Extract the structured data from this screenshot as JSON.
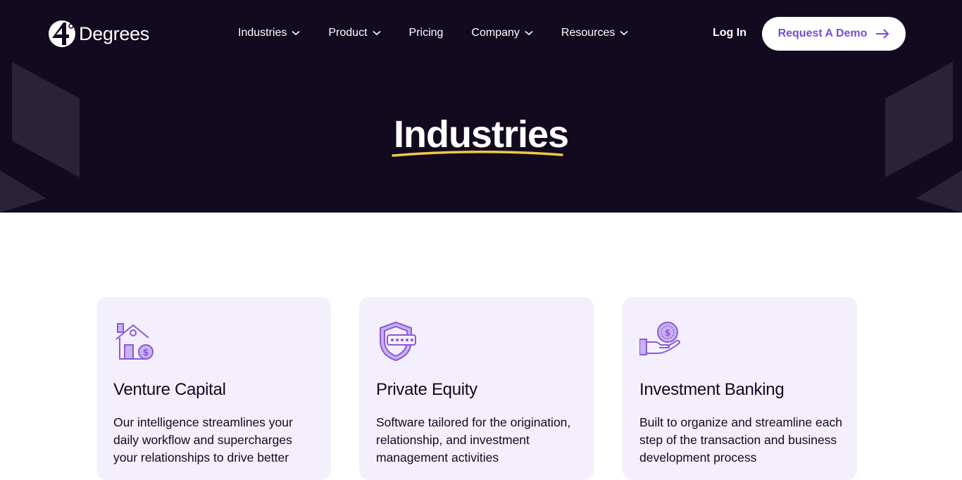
{
  "brand": {
    "logo_text": "Degrees",
    "logo_mark": "4"
  },
  "nav": {
    "items": [
      {
        "label": "Industries",
        "has_dropdown": true
      },
      {
        "label": "Product",
        "has_dropdown": true
      },
      {
        "label": "Pricing",
        "has_dropdown": false
      },
      {
        "label": "Company",
        "has_dropdown": true
      },
      {
        "label": "Resources",
        "has_dropdown": true
      }
    ],
    "login_label": "Log In",
    "demo_label": "Request A Demo"
  },
  "hero": {
    "title": "Industries"
  },
  "cards": [
    {
      "icon": "house-dollar-icon",
      "title": "Venture Capital",
      "text": "Our intelligence streamlines your daily workflow and supercharges your relationships to drive better"
    },
    {
      "icon": "shield-password-icon",
      "title": "Private Equity",
      "text": "Software tailored for the origination, relationship, and investment management activities"
    },
    {
      "icon": "hand-coin-icon",
      "title": "Investment Banking",
      "text": "Built to organize and streamline each step of the transaction and business development process"
    }
  ],
  "colors": {
    "hero_bg": "#120a1f",
    "accent": "#7b4bd9",
    "card_bg": "#f4effd",
    "underline": "#f5c842",
    "icon_stroke": "#8a5ad6",
    "icon_fill": "#c9b1f2"
  }
}
